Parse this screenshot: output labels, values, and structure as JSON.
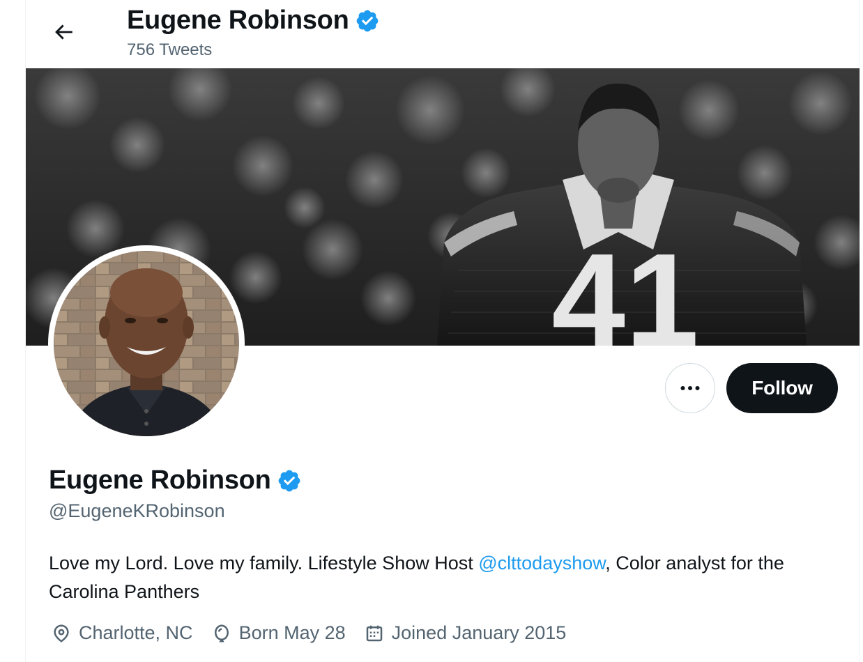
{
  "header": {
    "display_name": "Eugene Robinson",
    "tweet_count": "756 Tweets"
  },
  "profile": {
    "display_name": "Eugene Robinson",
    "handle": "@EugeneKRobinson",
    "bio_before": "Love my Lord. Love my family. Lifestyle Show Host ",
    "bio_mention": "@clttodayshow",
    "bio_after": ", Color analyst for the Carolina Panthers",
    "location": "Charlotte, NC",
    "birthday": "Born May 28",
    "joined": "Joined January 2015"
  },
  "banner": {
    "jersey_number": "41"
  },
  "actions": {
    "follow_label": "Follow"
  },
  "icons": {
    "back": "arrow-left-icon",
    "verified": "verified-badge-icon",
    "more": "more-horizontal-icon",
    "location": "location-pin-icon",
    "birthday": "balloon-icon",
    "joined": "calendar-icon"
  },
  "colors": {
    "accent": "#1d9bf0",
    "text_primary": "#0f1419",
    "text_secondary": "#536471",
    "follow_bg": "#0f1419",
    "border": "#cfd9de"
  }
}
